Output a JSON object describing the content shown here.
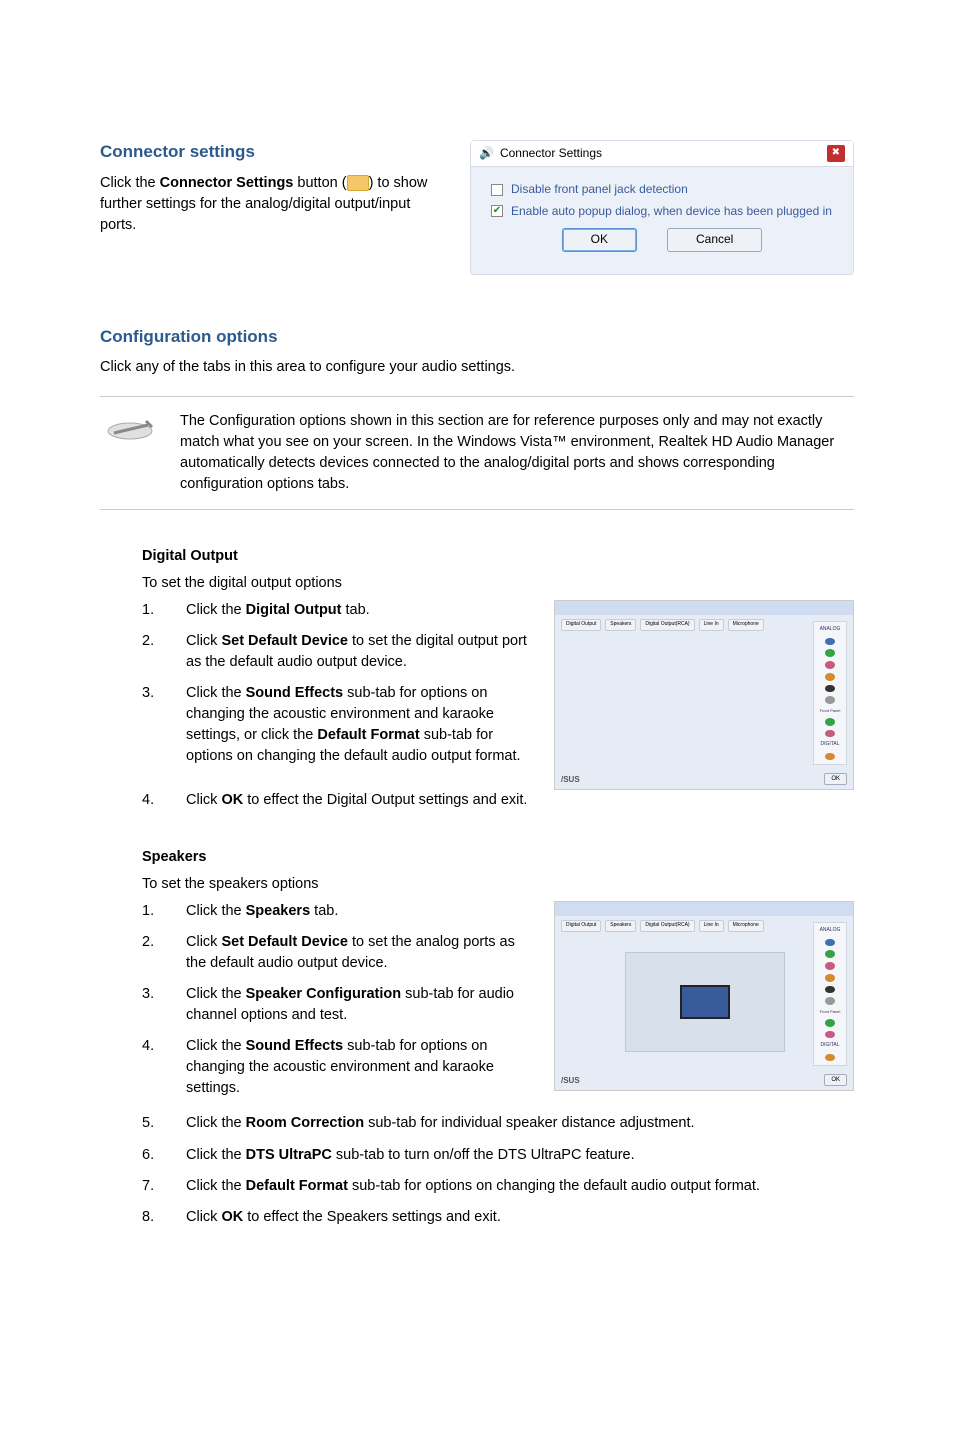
{
  "connector": {
    "heading": "Connector settings",
    "para_prefix": "Click the ",
    "para_bold": "Connector Settings",
    "para_mid": " button (",
    "para_suffix": ") to show further settings for the analog/digital output/input ports.",
    "dialog": {
      "title": "Connector Settings",
      "opt1": "Disable front panel jack detection",
      "opt2": "Enable auto popup dialog, when device has been plugged in",
      "ok": "OK",
      "cancel": "Cancel"
    }
  },
  "config": {
    "heading": "Configuration options",
    "intro": "Click any of the tabs in this area to configure your audio settings.",
    "note": "The Configuration options shown in this section are for reference purposes only and may not exactly match what you see on your screen. In the Windows Vista™ environment, Realtek HD Audio Manager automatically detects devices connected to the analog/digital ports and shows corresponding configuration options tabs."
  },
  "digital": {
    "heading": "Digital Output",
    "intro": "To set the digital output options",
    "items": [
      {
        "n": "1.",
        "t_pre": "Click the ",
        "t_b": "Digital Output",
        "t_post": " tab."
      },
      {
        "n": "2.",
        "t_pre": "Click ",
        "t_b": "Set Default Device",
        "t_post": " to set the digital output port as the default audio output device."
      },
      {
        "n": "3.",
        "t_pre": "Click the ",
        "t_b": "Sound Effects",
        "t_post": " sub-tab for options on changing the acoustic environment and karaoke settings, or click the ",
        "t_b2": "Default Format",
        "t_post2": " sub-tab for options on changing the default audio output format."
      },
      {
        "n": "4.",
        "t_pre": "Click ",
        "t_b": "OK",
        "t_post": " to effect the Digital Output settings and exit."
      }
    ]
  },
  "speakers": {
    "heading": "Speakers",
    "intro": "To set the speakers options",
    "items": [
      {
        "n": "1.",
        "t_pre": "Click the ",
        "t_b": "Speakers",
        "t_post": " tab."
      },
      {
        "n": "2.",
        "t_pre": "Click ",
        "t_b": "Set Default Device",
        "t_post": " to set the analog ports as the default audio output device."
      },
      {
        "n": "3.",
        "t_pre": "Click the ",
        "t_b": "Speaker Configuration",
        "t_post": " sub-tab for audio channel options and test."
      },
      {
        "n": "4.",
        "t_pre": "Click the ",
        "t_b": "Sound Effects",
        "t_post": " sub-tab for options on changing the acoustic environment and karaoke settings."
      },
      {
        "n": "5.",
        "t_pre": "Click the ",
        "t_b": "Room Correction",
        "t_post": " sub-tab for individual speaker distance adjustment."
      },
      {
        "n": "6.",
        "t_pre": "Click the ",
        "t_b": "DTS UltraPC",
        "t_post": " sub-tab to turn on/off the DTS UltraPC feature."
      },
      {
        "n": "7.",
        "t_pre": "Click the ",
        "t_b": "Default Format",
        "t_post": " sub-tab for options on changing the default audio output format."
      },
      {
        "n": "8.",
        "t_pre": "Click ",
        "t_b": "OK",
        "t_post": " to effect the Speakers settings and exit."
      }
    ]
  },
  "thumb": {
    "brand": "/SUS",
    "ok": "OK",
    "analog": "ANALOG",
    "digital": "DIGITAL",
    "front": "Front Panel"
  }
}
